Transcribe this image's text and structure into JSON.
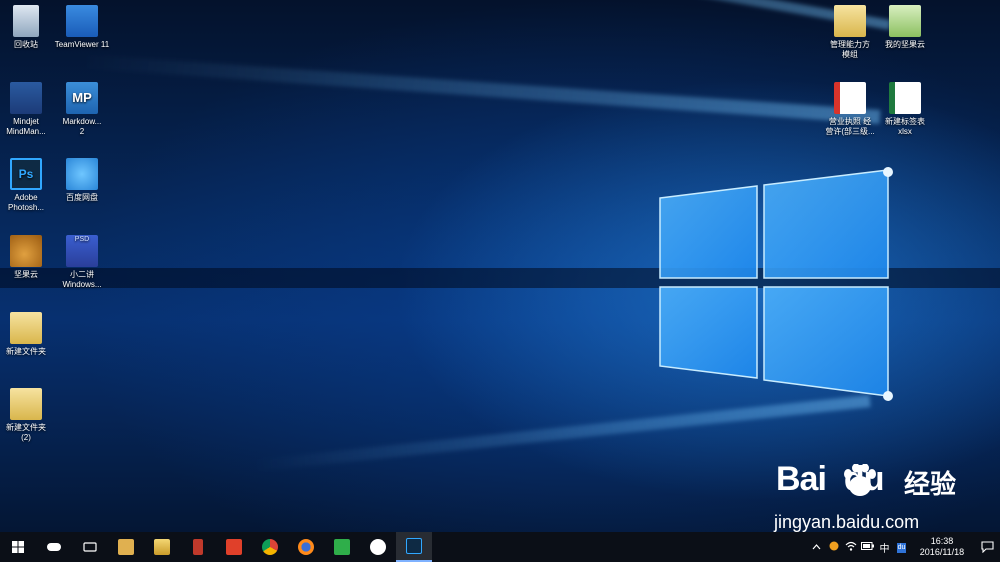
{
  "desktop_icons": {
    "recycle_bin": "回收站",
    "teamviewer": "TeamViewer 11",
    "mindjet_line1": "Mindjet",
    "mindjet_line2": "MindMan...",
    "markdown_line1": "Markdow...",
    "markdown_line2": "2",
    "markdown_badge": "MP",
    "photoshop_line1": "Adobe",
    "photoshop_line2": "Photosh...",
    "photoshop_badge": "Ps",
    "baidu_netdisk": "百度网盘",
    "jianguoyun": "坚果云",
    "psd_line1": "小二讲",
    "psd_line2": "Windows...",
    "psd_badge": "PSD",
    "new_folder": "新建文件夹",
    "new_folder2_line1": "新建文件夹",
    "new_folder2_line2": "(2)",
    "right_folder_line1": "管理能力方",
    "right_folder_line2": "模组",
    "right_jianguoyun": "我的坚果云",
    "right_pdf_line1": "营业执照 经",
    "right_pdf_line2": "营许(部三级...",
    "right_xls_line1": "新建标签表",
    "right_xls_line2": "xlsx"
  },
  "watermark": {
    "brand_left": "Bai",
    "brand_du": "du",
    "brand_cn": "经验",
    "url": "jingyan.baidu.com"
  },
  "taskbar": {
    "time": "16:38",
    "date": "2016/11/18",
    "ime": "中",
    "tray_badge": "du",
    "colors": {
      "accent": "#7fb2ff",
      "background": "#0b0f17"
    }
  }
}
